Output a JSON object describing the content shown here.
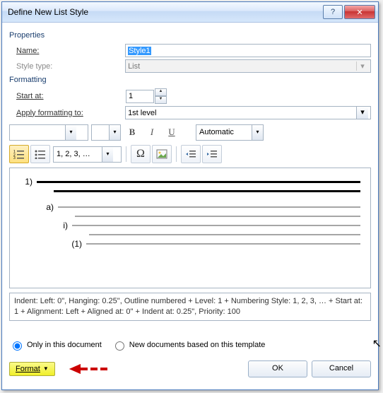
{
  "title": "Define New List Style",
  "properties": {
    "section_label": "Properties",
    "name_label": "Name:",
    "name_value": "Style1",
    "type_label": "Style type:",
    "type_value": "List"
  },
  "formatting": {
    "section_label": "Formatting",
    "start_label": "Start at:",
    "start_value": "1",
    "apply_label": "Apply formatting to:",
    "apply_value": "1st level",
    "bold": "B",
    "italic": "I",
    "underline": "U",
    "auto_color": "Automatic",
    "number_format": "1, 2, 3, …",
    "omega": "Ω"
  },
  "preview": {
    "l1": "1)",
    "l2": "a)",
    "l3": "i)",
    "l4": "(1)"
  },
  "description": "Indent: Left:  0\", Hanging:  0.25\", Outline numbered + Level: 1 + Numbering Style: 1, 2, 3, … + Start at: 1 + Alignment: Left + Aligned at:  0\" + Indent at:  0.25\", Priority: 100",
  "radios": {
    "only_doc": "Only in this document",
    "template": "New documents based on this template"
  },
  "buttons": {
    "format": "Format",
    "ok": "OK",
    "cancel": "Cancel"
  }
}
